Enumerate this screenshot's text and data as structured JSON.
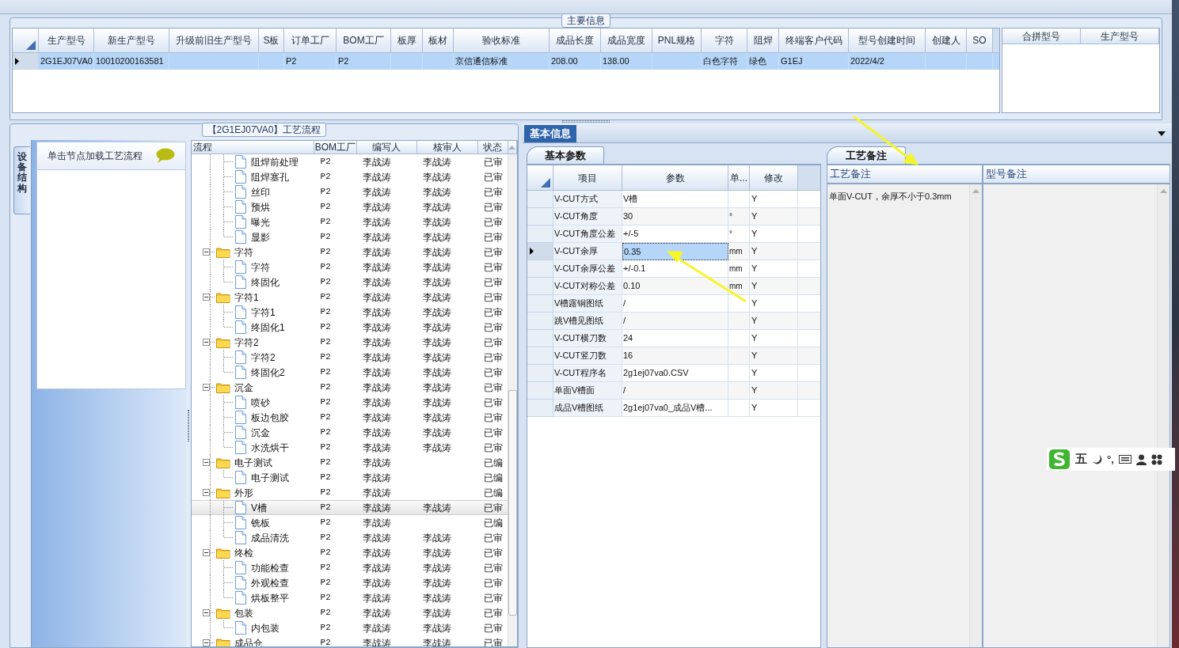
{
  "main_info": {
    "legend": "主要信息",
    "columns": [
      "生产型号",
      "新生产型号",
      "升级前旧生产型号",
      "S板",
      "订单工厂",
      "BOM工厂",
      "板厚",
      "板材",
      "验收标准",
      "成品长度",
      "成品宽度",
      "PNL规格",
      "字符",
      "阻焊",
      "终端客户代码",
      "型号创建时间",
      "创建人",
      "SO"
    ],
    "rows": [
      {
        "selected": true,
        "cells": [
          "2G1EJ07VA0",
          "10010200163581",
          null,
          null,
          "P2",
          "P2",
          null,
          null,
          "京信通信标准",
          "208.00",
          "138.00",
          null,
          "白色字符",
          "绿色",
          "G1EJ",
          "2022/4/2",
          null,
          null
        ]
      }
    ],
    "merge_columns": [
      "合拼型号",
      "生产型号"
    ]
  },
  "process": {
    "legend": "【2G1EJ07VA0】工艺流程",
    "side_tab": "设备结构",
    "hint": "单击节点加载工艺流程",
    "columns": [
      "流程",
      "BOM工厂",
      "编写人",
      "核审人",
      "状态"
    ],
    "nodes": [
      {
        "kind": "continued",
        "children": [
          {
            "kind": "file",
            "label": "阻焊前处理",
            "bom": "P2",
            "writer": "李战涛",
            "reviewer": "李战涛",
            "status": "已审",
            "selected": false
          },
          {
            "kind": "file",
            "label": "阻焊塞孔",
            "bom": "P2",
            "writer": "李战涛",
            "reviewer": "李战涛",
            "status": "已审",
            "selected": false
          },
          {
            "kind": "file",
            "label": "丝印",
            "bom": "P2",
            "writer": "李战涛",
            "reviewer": "李战涛",
            "status": "已审",
            "selected": false
          },
          {
            "kind": "file",
            "label": "预烘",
            "bom": "P2",
            "writer": "李战涛",
            "reviewer": "李战涛",
            "status": "已审",
            "selected": false
          },
          {
            "kind": "file",
            "label": "曝光",
            "bom": "P2",
            "writer": "李战涛",
            "reviewer": "李战涛",
            "status": "已审",
            "selected": false
          },
          {
            "kind": "file",
            "label": "显影",
            "bom": "P2",
            "writer": "李战涛",
            "reviewer": "李战涛",
            "status": "已审",
            "selected": false
          }
        ]
      },
      {
        "kind": "folder",
        "label": "字符",
        "bom": "P2",
        "writer": "李战涛",
        "reviewer": "李战涛",
        "status": "已审",
        "selected": false,
        "expanded": true,
        "children": [
          {
            "kind": "file",
            "label": "字符",
            "bom": "P2",
            "writer": "李战涛",
            "reviewer": "李战涛",
            "status": "已审",
            "selected": false
          },
          {
            "kind": "file",
            "label": "终固化",
            "bom": "P2",
            "writer": "李战涛",
            "reviewer": "李战涛",
            "status": "已审",
            "selected": false
          }
        ]
      },
      {
        "kind": "folder",
        "label": "字符1",
        "bom": "P2",
        "writer": "李战涛",
        "reviewer": "李战涛",
        "status": "已审",
        "selected": false,
        "expanded": true,
        "children": [
          {
            "kind": "file",
            "label": "字符1",
            "bom": "P2",
            "writer": "李战涛",
            "reviewer": "李战涛",
            "status": "已审",
            "selected": false
          },
          {
            "kind": "file",
            "label": "终固化1",
            "bom": "P2",
            "writer": "李战涛",
            "reviewer": "李战涛",
            "status": "已审",
            "selected": false
          }
        ]
      },
      {
        "kind": "folder",
        "label": "字符2",
        "bom": "P2",
        "writer": "李战涛",
        "reviewer": "李战涛",
        "status": "已审",
        "selected": false,
        "expanded": true,
        "children": [
          {
            "kind": "file",
            "label": "字符2",
            "bom": "P2",
            "writer": "李战涛",
            "reviewer": "李战涛",
            "status": "已审",
            "selected": false
          },
          {
            "kind": "file",
            "label": "终固化2",
            "bom": "P2",
            "writer": "李战涛",
            "reviewer": "李战涛",
            "status": "已审",
            "selected": false
          }
        ]
      },
      {
        "kind": "folder",
        "label": "沉金",
        "bom": "P2",
        "writer": "李战涛",
        "reviewer": "李战涛",
        "status": "已审",
        "selected": false,
        "expanded": true,
        "children": [
          {
            "kind": "file",
            "label": "喷砂",
            "bom": "P2",
            "writer": "李战涛",
            "reviewer": "李战涛",
            "status": "已审",
            "selected": false
          },
          {
            "kind": "file",
            "label": "板边包胶",
            "bom": "P2",
            "writer": "李战涛",
            "reviewer": "李战涛",
            "status": "已审",
            "selected": false
          },
          {
            "kind": "file",
            "label": "沉金",
            "bom": "P2",
            "writer": "李战涛",
            "reviewer": "李战涛",
            "status": "已审",
            "selected": false
          },
          {
            "kind": "file",
            "label": "水洗烘干",
            "bom": "P2",
            "writer": "李战涛",
            "reviewer": "李战涛",
            "status": "已审",
            "selected": false
          }
        ]
      },
      {
        "kind": "folder",
        "label": "电子测试",
        "bom": "P2",
        "writer": "李战涛",
        "status": "已编",
        "selected": false,
        "expanded": true,
        "children": [
          {
            "kind": "file",
            "label": "电子测试",
            "bom": "P2",
            "writer": "李战涛",
            "status": "已编",
            "selected": false
          }
        ]
      },
      {
        "kind": "folder",
        "label": "外形",
        "bom": "P2",
        "writer": "李战涛",
        "status": "已编",
        "selected": false,
        "expanded": true,
        "children": [
          {
            "kind": "file",
            "label": "V槽",
            "bom": "P2",
            "writer": "李战涛",
            "reviewer": "李战涛",
            "status": "已审",
            "selected": true
          },
          {
            "kind": "file",
            "label": "铣板",
            "bom": "P2",
            "writer": "李战涛",
            "status": "已编",
            "selected": false
          },
          {
            "kind": "file",
            "label": "成品清洗",
            "bom": "P2",
            "writer": "李战涛",
            "reviewer": "李战涛",
            "status": "已审",
            "selected": false
          }
        ]
      },
      {
        "kind": "folder",
        "label": "终检",
        "bom": "P2",
        "writer": "李战涛",
        "reviewer": "李战涛",
        "status": "已审",
        "selected": false,
        "expanded": true,
        "children": [
          {
            "kind": "file",
            "label": "功能检查",
            "bom": "P2",
            "writer": "李战涛",
            "reviewer": "李战涛",
            "status": "已审",
            "selected": false
          },
          {
            "kind": "file",
            "label": "外观检查",
            "bom": "P2",
            "writer": "李战涛",
            "reviewer": "李战涛",
            "status": "已审",
            "selected": false
          },
          {
            "kind": "file",
            "label": "烘板整平",
            "bom": "P2",
            "writer": "李战涛",
            "reviewer": "李战涛",
            "status": "已审",
            "selected": false
          }
        ]
      },
      {
        "kind": "folder",
        "label": "包装",
        "bom": "P2",
        "writer": "李战涛",
        "reviewer": "李战涛",
        "status": "已审",
        "selected": false,
        "expanded": true,
        "children": [
          {
            "kind": "file",
            "label": "内包装",
            "bom": "P2",
            "writer": "李战涛",
            "reviewer": "李战涛",
            "status": "已审",
            "selected": false
          }
        ]
      },
      {
        "kind": "folder",
        "label": "成品仓",
        "bom": "P2",
        "writer": "李战涛",
        "reviewer": "李战涛",
        "status": "已审",
        "selected": false,
        "expanded": true
      }
    ]
  },
  "detail_tabs": [
    {
      "label": "基本信息",
      "selected": true
    }
  ],
  "params": {
    "tab": "基本参数",
    "columns": [
      "项目",
      "参数",
      "单...",
      "修改"
    ],
    "rows": [
      {
        "item": "V-CUT方式",
        "value": "V槽",
        "modify": "Y",
        "selected": false
      },
      {
        "item": "V-CUT角度",
        "value": "30",
        "unit": "°",
        "modify": "Y",
        "selected": false
      },
      {
        "item": "V-CUT角度公差",
        "value": "+/-5",
        "unit": "°",
        "modify": "Y",
        "selected": false
      },
      {
        "item": "V-CUT余厚",
        "value": "0.35",
        "unit": "mm",
        "modify": "Y",
        "selected": true
      },
      {
        "item": "V-CUT余厚公差",
        "value": "+/-0.1",
        "unit": "mm",
        "modify": "Y",
        "selected": false
      },
      {
        "item": "V-CUT对称公差",
        "value": "0.10",
        "unit": "mm",
        "modify": "Y",
        "selected": false
      },
      {
        "item": "V槽露铜图纸",
        "value": "/",
        "modify": "Y",
        "selected": false
      },
      {
        "item": "跳V槽见图纸",
        "value": "/",
        "modify": "Y",
        "selected": false
      },
      {
        "item": "V-CUT横刀数",
        "value": "24",
        "modify": "Y",
        "selected": false
      },
      {
        "item": "V-CUT竖刀数",
        "value": "16",
        "modify": "Y",
        "selected": false
      },
      {
        "item": "V-CUT程序名",
        "value": "2g1ej07va0.CSV",
        "modify": "Y",
        "selected": false
      },
      {
        "item": "单面V槽面",
        "value": "/",
        "modify": "Y",
        "selected": false
      },
      {
        "item": "成品V槽图纸",
        "value": "2g1ej07va0_成品V槽...",
        "modify": "Y",
        "selected": false
      }
    ]
  },
  "notes": {
    "tab": "工艺备注",
    "process_note": {
      "title": "工艺备注",
      "text": "单面V-CUT，余厚不小于0.3mm"
    },
    "model_note": {
      "title": "型号备注"
    }
  },
  "ime_bar": {
    "mode": "五",
    "punct": "°,"
  }
}
